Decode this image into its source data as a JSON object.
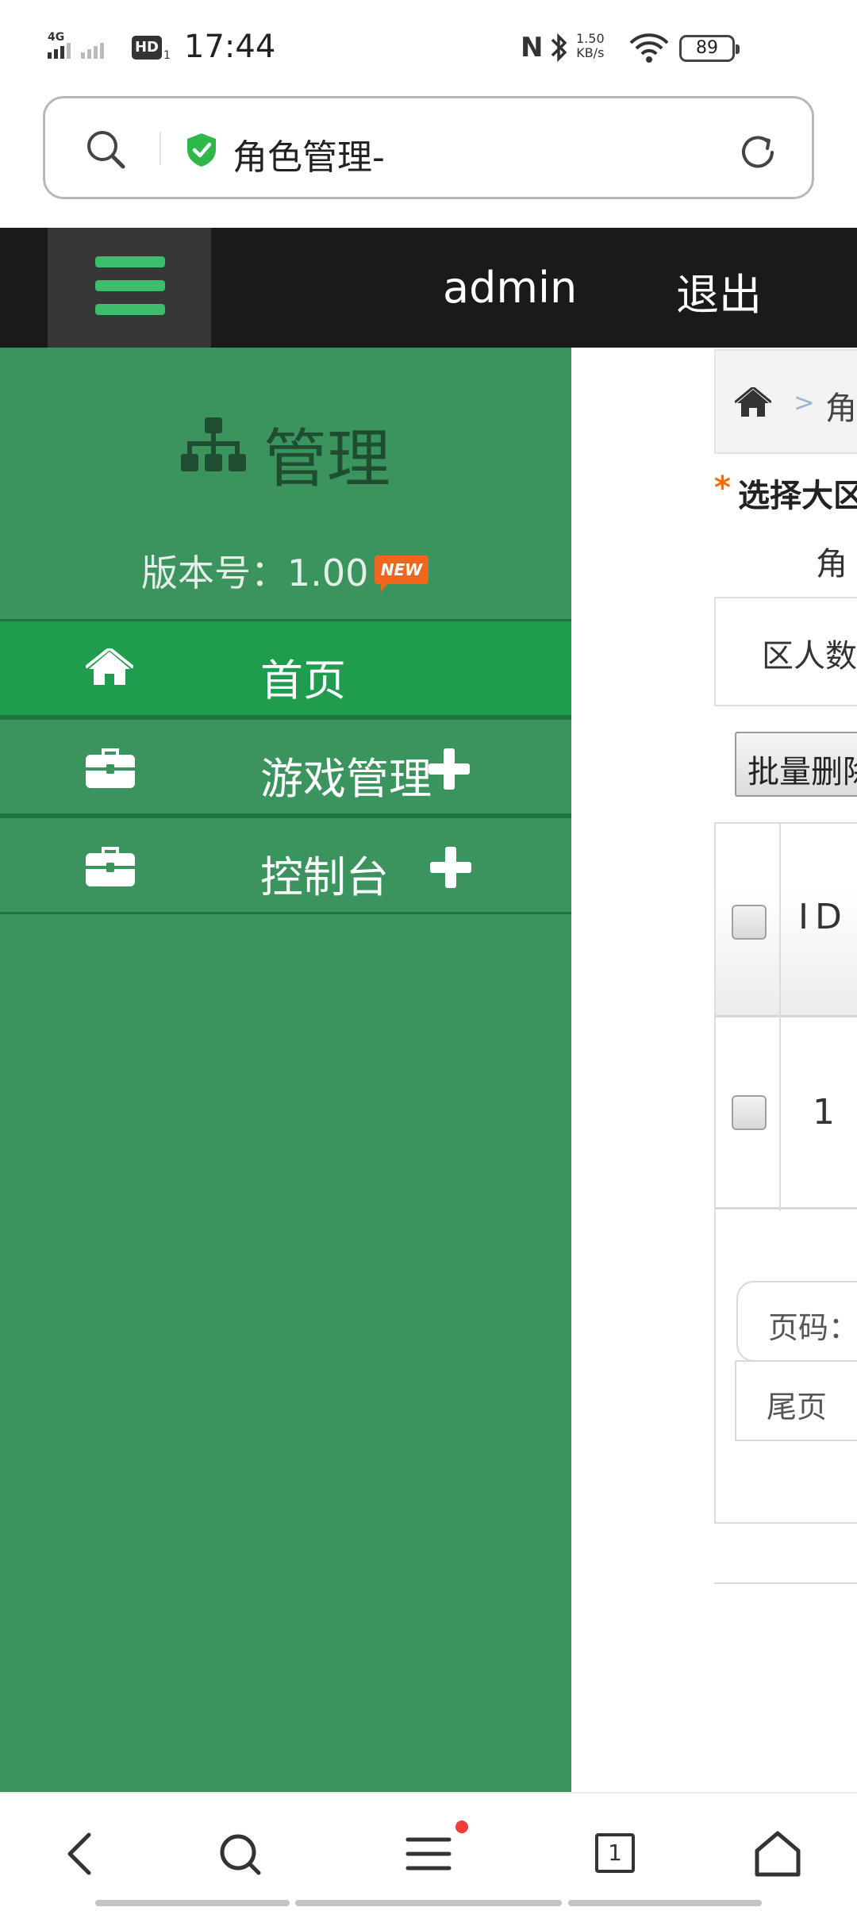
{
  "status_bar": {
    "network": "4G",
    "hd_label": "HD",
    "hd_sub": "1",
    "time": "17:44",
    "nfc": "N",
    "speed_value": "1.50",
    "speed_unit": "KB/s",
    "battery": "89"
  },
  "address_bar": {
    "page_title": "角色管理-"
  },
  "top_nav": {
    "user": "admin",
    "logout": "退出"
  },
  "sidebar": {
    "brand": "管理",
    "version": "版本号：1.00",
    "new_badge": "NEW",
    "items": [
      {
        "label": "首页",
        "icon": "home-icon",
        "active": true
      },
      {
        "label": "游戏管理",
        "icon": "briefcase-icon",
        "expand": "+"
      },
      {
        "label": "控制台",
        "icon": "briefcase-icon",
        "expand": "+"
      }
    ]
  },
  "main": {
    "breadcrumb_sep": ">",
    "breadcrumb_current": "角",
    "required_mark": "*",
    "select_zone_label": "选择大区",
    "role_label": "角",
    "zone_count_label": "区人数",
    "batch_delete_label": "批量删除",
    "table": {
      "columns": [
        "ID"
      ],
      "rows": [
        {
          "id": "1"
        }
      ]
    },
    "pager": {
      "page_label": "页码：",
      "last_page_label": "尾页"
    }
  },
  "colors": {
    "sidebar_bg": "#3b935e",
    "sidebar_active": "#1f9c4e",
    "nav_bg": "#1a1a1a",
    "accent_green": "#3ebd6d",
    "badge_orange": "#f1661d",
    "required_orange": "#ff6a00"
  }
}
